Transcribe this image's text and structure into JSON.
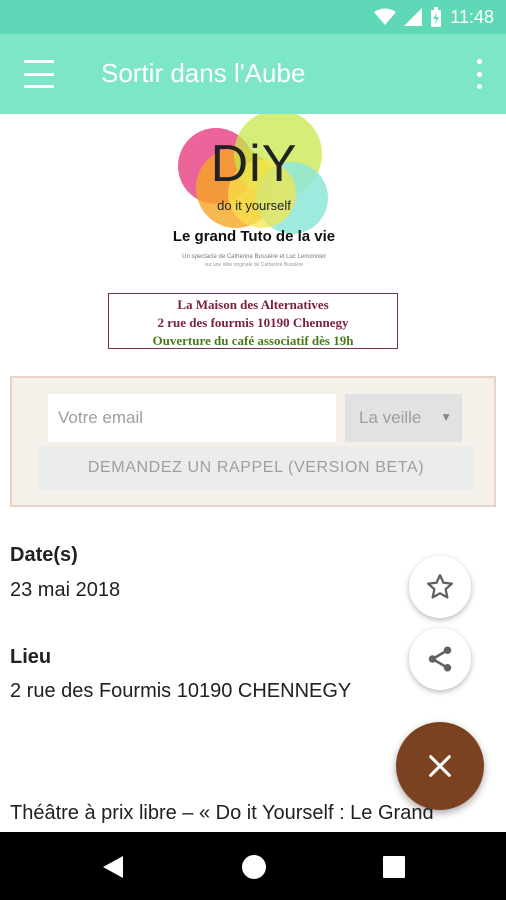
{
  "status_bar": {
    "time": "11:48"
  },
  "app_bar": {
    "title": "Sortir dans l'Aube"
  },
  "poster": {
    "logo_text": "DiY",
    "logo_subtitle": "do it yourself",
    "tagline": "Le grand Tuto de la vie",
    "small_line_1": "Un spectacle de Catherine Bussière et Luc Lemonnier",
    "small_line_2": "sur une idée originale de Catherine Bussière",
    "venue_name": "La Maison des Alternatives",
    "venue_address": "2 rue des fourmis 10190 Chennegy",
    "venue_note": "Ouverture du café associatif dès 19h",
    "colors": [
      "#e84a8a",
      "#f5a623",
      "#c7e84a",
      "#8ee6d8",
      "#f7e64a"
    ]
  },
  "reminder": {
    "email_placeholder": "Votre email",
    "select_value": "La veille",
    "button_label": "DEMANDEZ UN RAPPEL (VERSION BETA)"
  },
  "details": {
    "date_label": "Date(s)",
    "date_value": "23 mai 2018",
    "lieu_label": "Lieu",
    "lieu_value": "2 rue des Fourmis 10190 CHENNEGY",
    "description": "Théâtre à prix libre – « Do it Yourself : Le Grand"
  },
  "colors": {
    "status_bar": "#5fd8b8",
    "app_bar": "#7de6c8",
    "fab_close": "#7a4220"
  },
  "icons": {
    "menu": "menu-icon",
    "overflow": "more-vert-icon",
    "favorite": "star-outline-icon",
    "share": "share-icon",
    "close": "close-icon",
    "back": "back-triangle-icon",
    "home": "home-circle-icon",
    "recents": "recents-square-icon"
  }
}
